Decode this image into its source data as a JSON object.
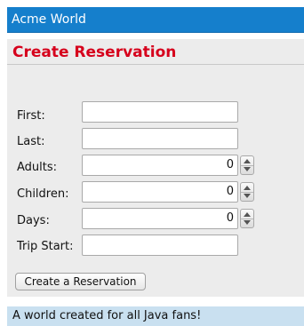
{
  "header": {
    "title": "Acme World"
  },
  "form": {
    "title": "Create Reservation",
    "fields": {
      "first": {
        "label": "First:",
        "value": ""
      },
      "last": {
        "label": "Last:",
        "value": ""
      },
      "adults": {
        "label": "Adults:",
        "value": "0"
      },
      "children": {
        "label": "Children:",
        "value": "0"
      },
      "days": {
        "label": "Days:",
        "value": "0"
      },
      "trip_start": {
        "label": "Trip Start:",
        "value": ""
      }
    },
    "submit_label": "Create a Reservation"
  },
  "footer": {
    "text": "A world created for all Java fans!"
  },
  "colors": {
    "header_bg": "#157fcc",
    "title_red": "#d6001c",
    "panel_bg": "#ececec",
    "footer_bg": "#c9e0f0"
  }
}
